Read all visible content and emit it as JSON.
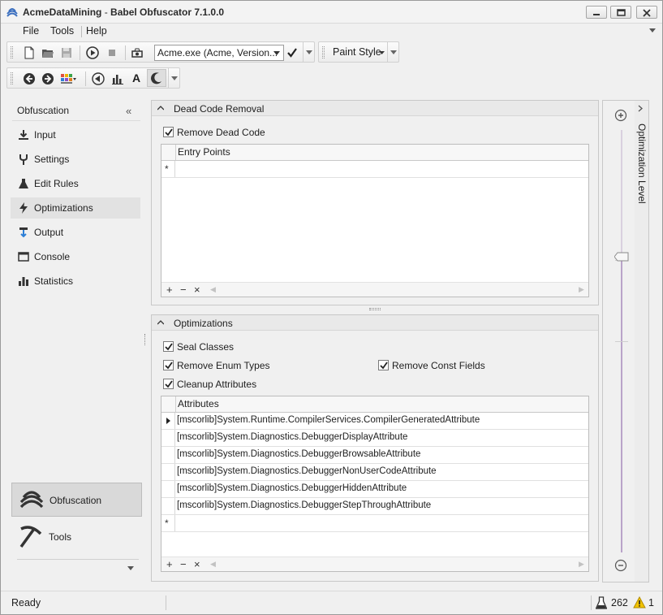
{
  "window": {
    "title_app": "AcmeDataMining",
    "title_sep": " - ",
    "title_product": "Babel Obfuscator 7.1.0.0",
    "buttons": [
      "minimize",
      "maximize",
      "close"
    ]
  },
  "menu": {
    "items": [
      "File",
      "Tools",
      "Help"
    ],
    "active": "Help"
  },
  "toolbar1": {
    "icons": [
      "new-file-icon",
      "open-folder-icon",
      "save-icon",
      "play-icon",
      "stop-icon",
      "build-icon"
    ],
    "target": "Acme.exe (Acme, Version...",
    "check_icon": "checkmark-icon",
    "paint_style": "Paint Style"
  },
  "toolbar2": {
    "icons": [
      "back-icon",
      "forward-icon",
      "grid-color-icon",
      "rewind-icon",
      "bar-chart-icon",
      "font-icon",
      "moon-icon"
    ],
    "font_glyph": "A"
  },
  "nav": {
    "header": "Obfuscation",
    "collapse_glyph": "«",
    "items": [
      {
        "label": "Input",
        "icon": "download-icon"
      },
      {
        "label": "Settings",
        "icon": "tuning-fork-icon"
      },
      {
        "label": "Edit Rules",
        "icon": "flask-icon"
      },
      {
        "label": "Optimizations",
        "icon": "lightning-icon"
      },
      {
        "label": "Output",
        "icon": "output-icon"
      },
      {
        "label": "Console",
        "icon": "console-window-icon"
      },
      {
        "label": "Statistics",
        "icon": "statistics-icon"
      }
    ],
    "active_item": "Optimizations",
    "bottom": [
      {
        "label": "Obfuscation",
        "icon": "obfuscation-icon"
      },
      {
        "label": "Tools",
        "icon": "pickaxe-icon"
      }
    ],
    "active_bottom": "Obfuscation"
  },
  "dead_code": {
    "title": "Dead Code Removal",
    "remove_dead_code": {
      "label": "Remove Dead Code",
      "checked": true
    },
    "grid": {
      "column": "Entry Points",
      "rows": [],
      "new_row_glyph": "*"
    }
  },
  "optimizations": {
    "title": "Optimizations",
    "seal_classes": {
      "label": "Seal Classes",
      "checked": true
    },
    "remove_enum_types": {
      "label": "Remove Enum Types",
      "checked": true
    },
    "remove_const_fields": {
      "label": "Remove Const Fields",
      "checked": true
    },
    "cleanup_attributes": {
      "label": "Cleanup Attributes",
      "checked": true
    },
    "grid": {
      "column": "Attributes",
      "rows": [
        "[mscorlib]System.Runtime.CompilerServices.CompilerGeneratedAttribute",
        "[mscorlib]System.Diagnostics.DebuggerDisplayAttribute",
        "[mscorlib]System.Diagnostics.DebuggerBrowsableAttribute",
        "[mscorlib]System.Diagnostics.DebuggerNonUserCodeAttribute",
        "[mscorlib]System.Diagnostics.DebuggerHiddenAttribute",
        "[mscorlib]System.Diagnostics.DebuggerStepThroughAttribute"
      ],
      "current_row": 0,
      "new_row_glyph": "*"
    }
  },
  "grid_footer": {
    "add": "+",
    "remove": "−",
    "delete": "×",
    "left": "◀",
    "right": "▶"
  },
  "side_panel": {
    "title": "Optimization Level",
    "level_fraction": 0.31,
    "plus_icon": "zoom-in-icon",
    "minus_icon": "zoom-out-icon"
  },
  "status": {
    "text": "Ready",
    "count_flask": "262",
    "count_warning": "1"
  },
  "colors": {
    "accent": "#3b6fbf",
    "slider": "#b9a3c9",
    "warning": "#f2c300"
  }
}
